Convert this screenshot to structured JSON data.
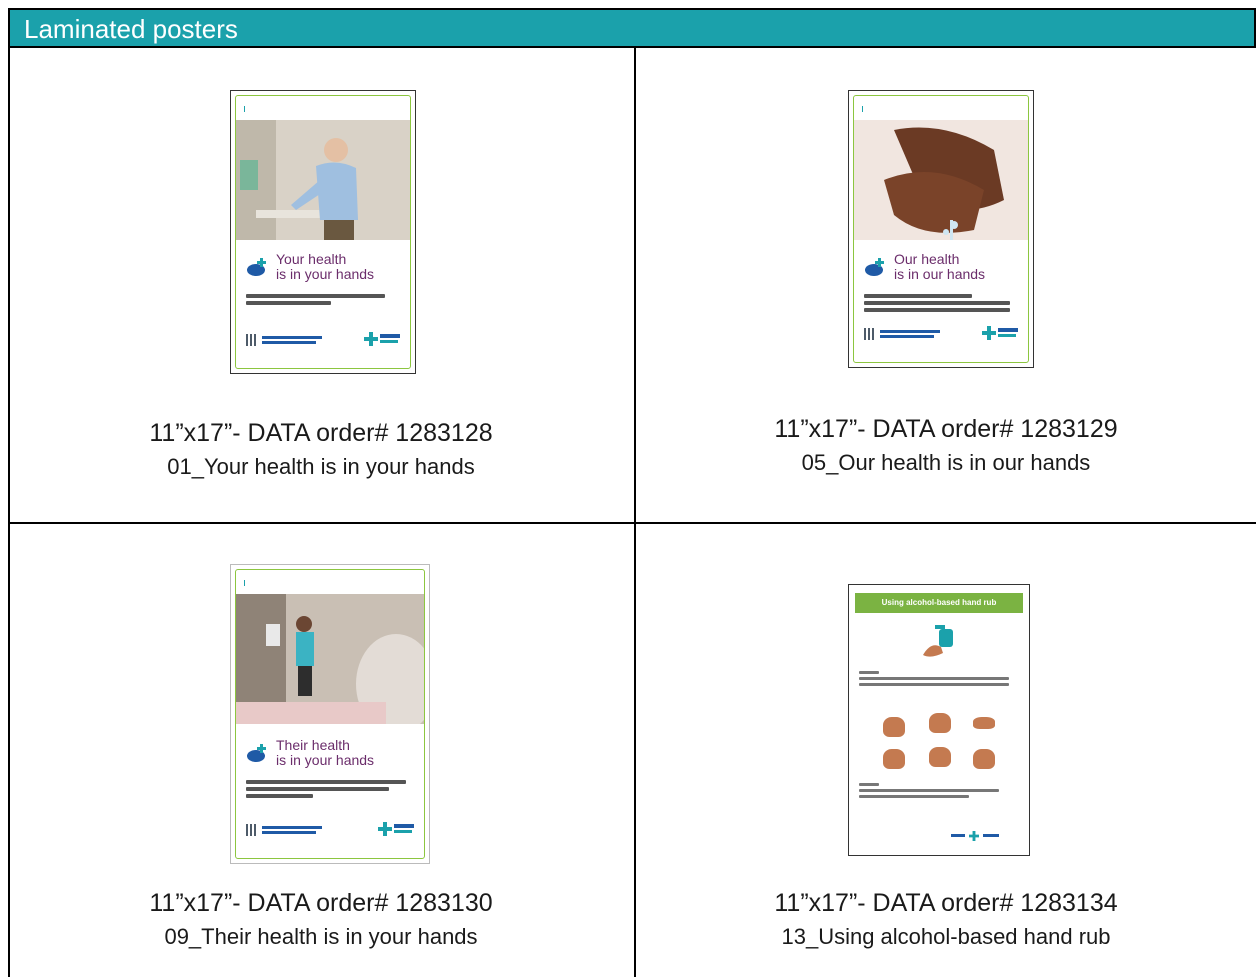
{
  "header": {
    "title": "Laminated posters"
  },
  "items": [
    {
      "caption_order": "11”x17”- DATA order# 1283128",
      "caption_name": "01_Your health is in your hands",
      "poster_title_1": "Your health",
      "poster_title_2": "is in your hands"
    },
    {
      "caption_order": "11”x17”- DATA order# 1283129",
      "caption_name": "05_Our health is in our hands",
      "poster_title_1": "Our health",
      "poster_title_2": "is in our hands"
    },
    {
      "caption_order": "11”x17”- DATA order# 1283130",
      "caption_name": "09_Their health is in your hands",
      "poster_title_1": "Their health",
      "poster_title_2": "is in your hands"
    },
    {
      "caption_order": "11”x17”- DATA order# 1283134",
      "caption_name": "13_Using alcohol-based hand rub",
      "poster_band": "Using alcohol-based hand rub"
    }
  ],
  "colors": {
    "header_bg": "#1ba1ab",
    "poster_title": "#6b2d6b",
    "accent_green": "#8cc63f"
  }
}
